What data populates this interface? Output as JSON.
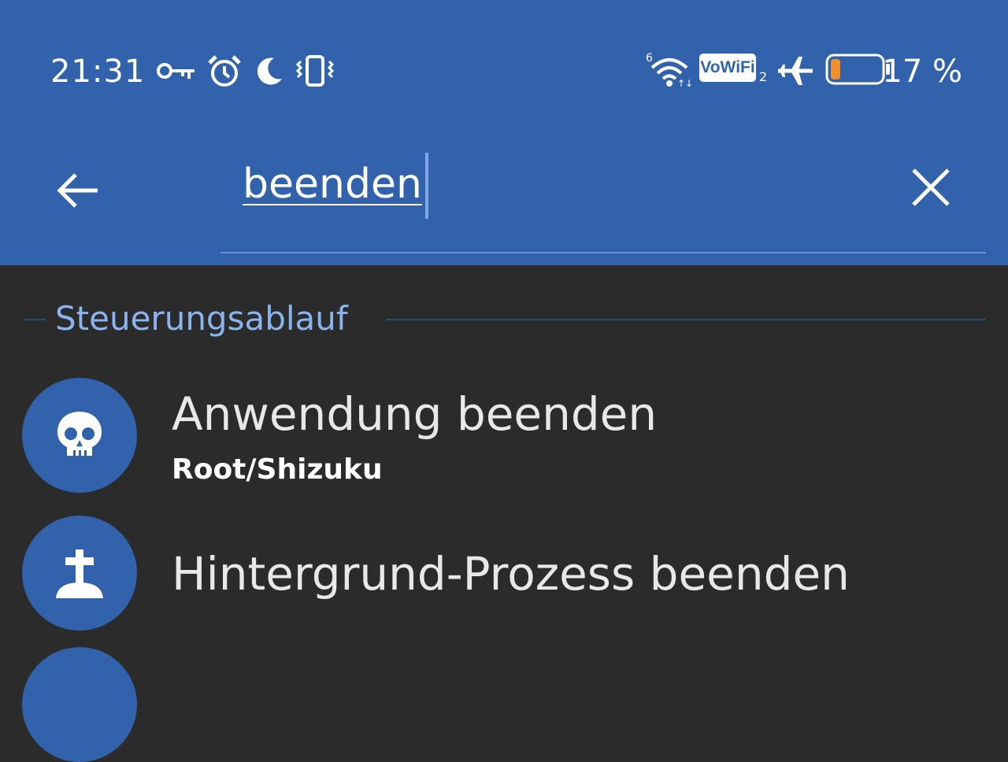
{
  "status_bar": {
    "time": "21:31",
    "vowifi_label": "VoWiFi",
    "vowifi_sub": "2",
    "battery_percent": "17 %",
    "battery_level": 0.17,
    "icons": [
      "key-icon",
      "alarm-icon",
      "moon-icon",
      "vibrate-icon",
      "wifi-icon",
      "vowifi-badge",
      "airplane-icon",
      "battery-icon"
    ]
  },
  "search": {
    "value": "beenden",
    "back_icon": "arrow-left-icon",
    "clear_icon": "close-icon"
  },
  "section": {
    "title": "Steuerungsablauf"
  },
  "results": [
    {
      "title": "Anwendung beenden",
      "subtitle": "Root/Shizuku",
      "icon": "skull-icon"
    },
    {
      "title": "Hintergrund-Prozess beenden",
      "icon": "grave-icon"
    }
  ],
  "colors": {
    "appbar": "#3162ab",
    "background": "#2b2b2b",
    "section_title": "#8ab4f0",
    "battery_fill": "#f0902a"
  }
}
